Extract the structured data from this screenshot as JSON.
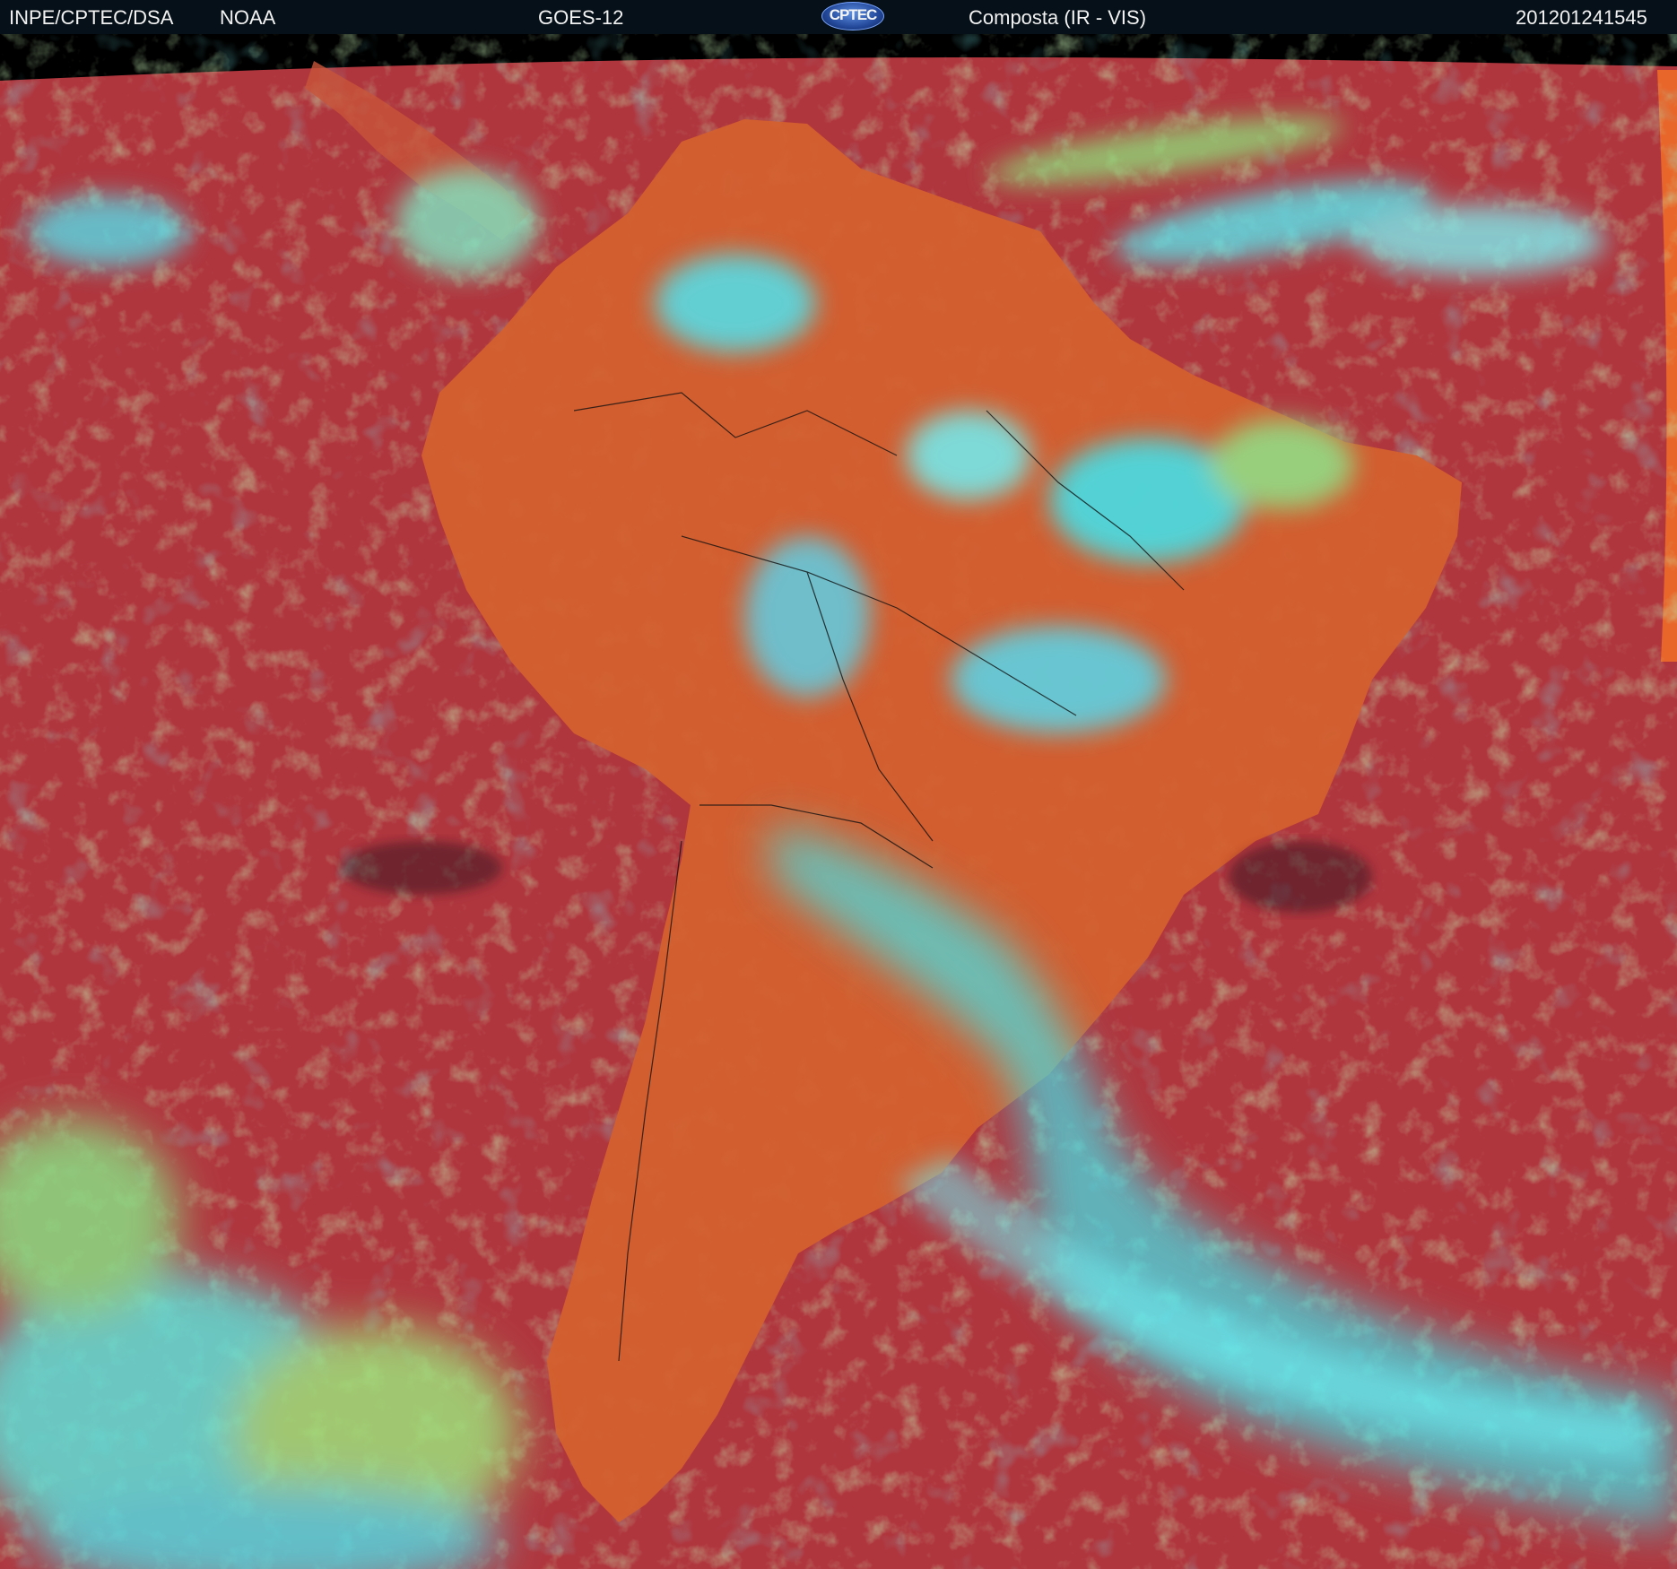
{
  "header": {
    "source": "INPE/CPTEC/DSA",
    "agency": "NOAA",
    "satellite": "GOES-12",
    "logo_text": "CPTEC",
    "product": "Composta (IR - VIS)",
    "timestamp": "201201241545"
  },
  "colors": {
    "header_bg": "#061018",
    "ocean": "#b0363e",
    "land": "#d4602e",
    "clouds_low": "#8fdc78",
    "clouds_high": "#38e8f0",
    "borders": "#111111"
  }
}
